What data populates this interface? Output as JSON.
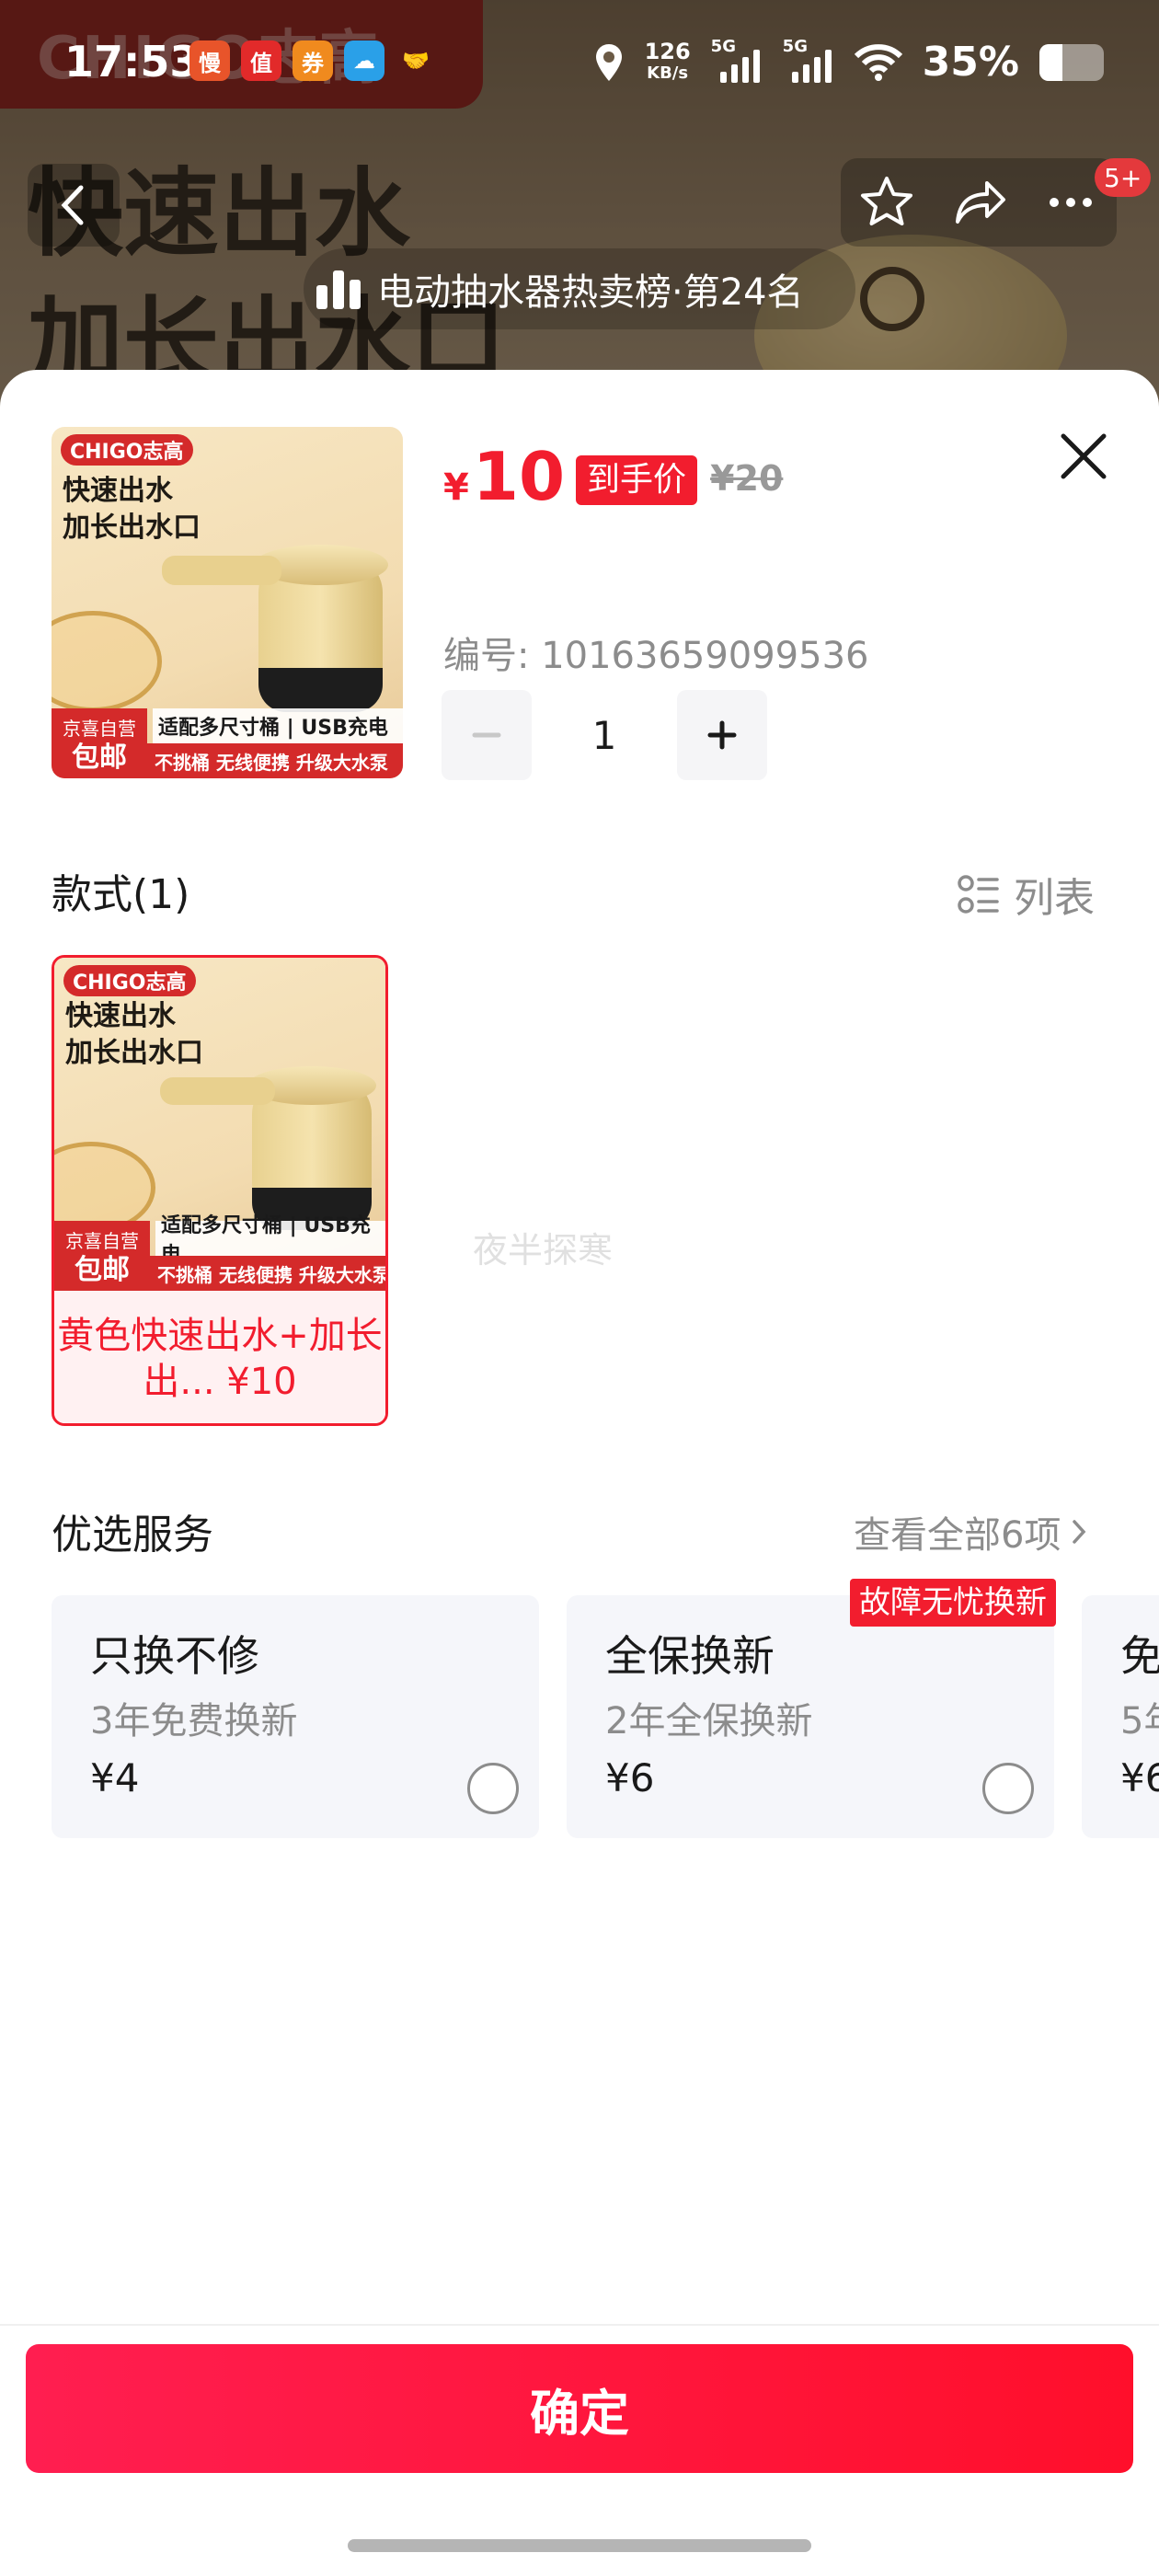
{
  "status_bar": {
    "time": "17:53",
    "net_speed_value": "126",
    "net_speed_unit": "KB/s",
    "sim1_label": "5G",
    "sim2_label": "5G",
    "battery_percent": "35%",
    "battery_level": 0.35,
    "app_icons": [
      {
        "name": "app-icon-slow",
        "glyph": "慢",
        "color": "#e8542a"
      },
      {
        "name": "app-icon-zhi",
        "glyph": "值",
        "color": "#e22a2a"
      },
      {
        "name": "app-icon-coupon",
        "glyph": "券",
        "color": "#f08a1e"
      },
      {
        "name": "app-icon-cloud-ai",
        "glyph": "☁",
        "color": "#2aa0e8"
      },
      {
        "name": "app-icon-handshake",
        "glyph": "🤝",
        "color": "transparent"
      }
    ]
  },
  "background": {
    "brand_text": "CHIGO志高",
    "hero_title_line1": "快速出水",
    "hero_title_line2": "加长出水口",
    "cart_badge": "5+",
    "rank_text": "电动抽水器热卖榜·第24名"
  },
  "product": {
    "currency": "¥",
    "price": "10",
    "price_tag": "到手价",
    "original_price": "¥20",
    "sku_label": "编号: 10163659099536",
    "quantity": "1",
    "thumb": {
      "brand": "CHIGO志高",
      "title_line1": "快速出水",
      "title_line2": "加长出水口",
      "badge_line1": "京喜自营",
      "badge_line2": "包邮",
      "feature_row1": "适配多尺寸桶 | USB充电",
      "feature_row2": "不挑桶 无线便携 升级大水泵"
    }
  },
  "style_section": {
    "title": "款式(1)",
    "list_toggle_label": "列表",
    "variants": [
      {
        "label": "黄色快速出水+加长出... ¥10"
      }
    ],
    "watermark": "夜半探寒"
  },
  "services": {
    "title": "优选服务",
    "more_label": "查看全部6项",
    "tag": "故障无忧换新",
    "cards": [
      {
        "name": "只换不修",
        "desc": "3年免费换新",
        "price": "¥4"
      },
      {
        "name": "全保换新",
        "desc": "2年全保换新",
        "price": "¥6"
      },
      {
        "name": "免",
        "desc": "5年",
        "price": "¥6"
      }
    ]
  },
  "confirm_label": "确定"
}
